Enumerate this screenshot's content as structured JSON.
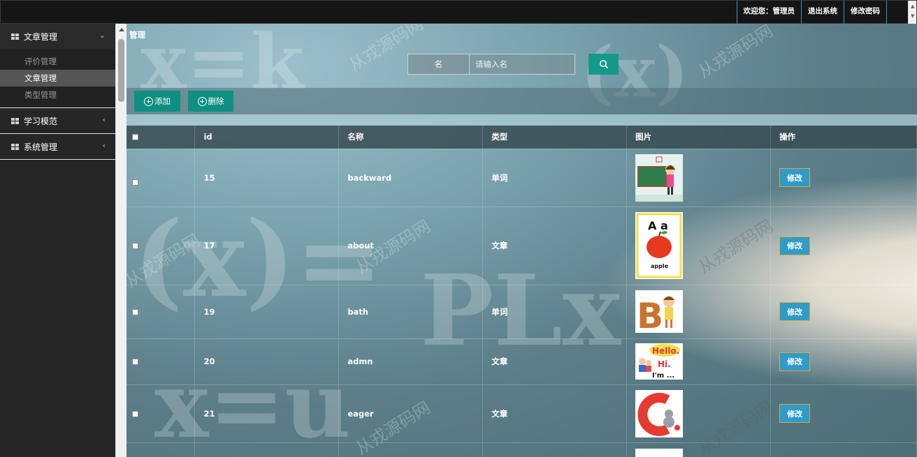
{
  "header": {
    "welcome": "欢迎您：管理员",
    "logout": "退出系统",
    "change_password": "修改密码"
  },
  "sidebar": {
    "groups": [
      {
        "label": "文章管理",
        "expanded": true,
        "items": [
          {
            "label": "评价管理",
            "active": false
          },
          {
            "label": "文章管理",
            "active": true
          },
          {
            "label": "类型管理",
            "active": false
          }
        ]
      },
      {
        "label": "学习模范",
        "expanded": false,
        "items": []
      },
      {
        "label": "系统管理",
        "expanded": false,
        "items": []
      }
    ]
  },
  "main": {
    "breadcrumb": "管理",
    "search": {
      "label": "名",
      "placeholder": "请输入名",
      "value": ""
    },
    "buttons": {
      "add": "添加",
      "delete": "删除"
    },
    "table": {
      "columns": [
        "id",
        "名称",
        "类型",
        "图片",
        "操作"
      ],
      "rows": [
        {
          "id": "15",
          "name": "backward",
          "type": "单词",
          "image": "teacher-at-blackboard",
          "action": "修改"
        },
        {
          "id": "17",
          "name": "about",
          "type": "文章",
          "image": "apple-card-Aa",
          "action": "修改"
        },
        {
          "id": "19",
          "name": "bath",
          "type": "单词",
          "image": "letter-B-girl",
          "action": "修改"
        },
        {
          "id": "20",
          "name": "admn",
          "type": "文章",
          "image": "hello-hi-kids",
          "action": "修改"
        },
        {
          "id": "21",
          "name": "eager",
          "type": "文章",
          "image": "letter-C-cat",
          "action": "修改"
        }
      ]
    }
  },
  "watermark": "从戎源码网",
  "colors": {
    "accent_green": "#15998a",
    "edit_blue": "#2e9bc9",
    "sidebar_bg": "#262626"
  }
}
